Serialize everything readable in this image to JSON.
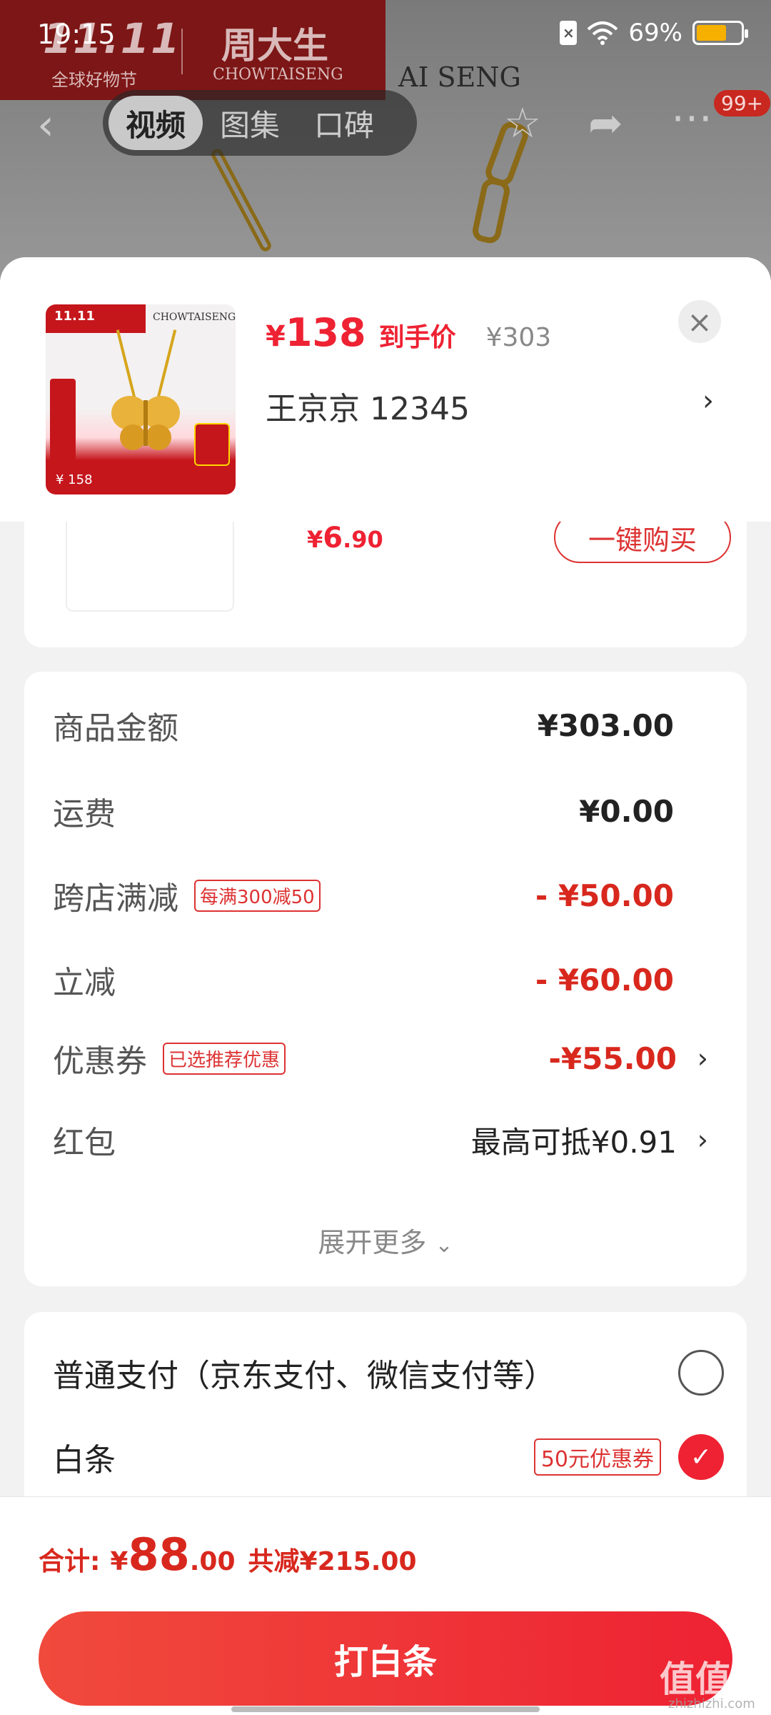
{
  "status_bar": {
    "time": "19:15",
    "battery_percent": "69%"
  },
  "background": {
    "banner_1111": "11.11",
    "banner_sub": "全球好物节",
    "brand_cn": "周大生",
    "brand_en": "CHOWTAISENG",
    "brand_overlay_text": "AI SENG",
    "tabs": [
      "视频",
      "图集",
      "口碑"
    ],
    "active_tab_index": 0,
    "notification_badge": "99+"
  },
  "sheet": {
    "product_thumb": {
      "promo": "11.11",
      "brand": "CHOWTAISENG",
      "price_tag": "¥ 158"
    },
    "price_currency": "¥",
    "price": "138",
    "price_label": "到手价",
    "original_price": "¥303",
    "user_line": "王京京  12345",
    "partial_item": {
      "price_prefix": "¥",
      "price_int": "6",
      "price_dec": ".90",
      "buy_button": "一键购买"
    }
  },
  "breakdown": {
    "rows": [
      {
        "label": "商品金额",
        "tag": "",
        "value": "¥303.00",
        "style": "black"
      },
      {
        "label": "运费",
        "tag": "",
        "value": "¥0.00",
        "style": "black"
      },
      {
        "label": "跨店满减",
        "tag": "每满300减50",
        "value": "- ¥50.00",
        "style": "red"
      },
      {
        "label": "立减",
        "tag": "",
        "value": "- ¥60.00",
        "style": "red"
      },
      {
        "label": "优惠券",
        "tag": "已选推荐优惠",
        "value": "-¥55.00",
        "style": "red"
      },
      {
        "label": "红包",
        "tag": "",
        "value": "最高可抵¥0.91",
        "style": "normal"
      }
    ],
    "expand_more": "展开更多"
  },
  "payment": {
    "options": [
      {
        "label": "普通支付（京东支付、微信支付等）",
        "tag": "",
        "selected": false
      },
      {
        "label": "白条",
        "tag": "50元优惠券",
        "selected": true
      }
    ]
  },
  "footer": {
    "total_label": "合计:",
    "total_currency": "¥",
    "total_int": "88",
    "total_dec": ".00",
    "saved_text": "共减¥215.00",
    "pay_button": "打白条"
  },
  "watermark": {
    "text": "值值值",
    "sub": "zhizhizhi.com"
  },
  "colors": {
    "accent_red": "#ee2233",
    "price_red": "#d8281e",
    "banner_red": "#c5161c"
  }
}
